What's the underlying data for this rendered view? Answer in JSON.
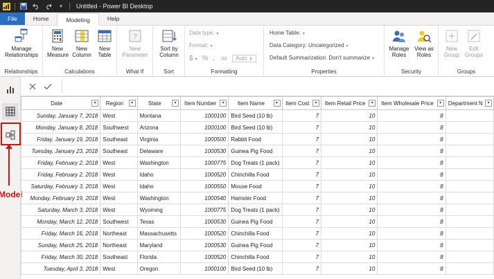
{
  "window": {
    "title": "Untitled - Power BI Desktop"
  },
  "tabs": [
    {
      "label": "File"
    },
    {
      "label": "Home"
    },
    {
      "label": "Modeling"
    },
    {
      "label": "Help"
    }
  ],
  "ribbon": {
    "relationships": {
      "manage_label": "Manage Relationships",
      "group": "Relationships"
    },
    "calculations": {
      "new_measure": "New Measure",
      "new_column": "New Column",
      "new_table": "New Table",
      "group": "Calculations"
    },
    "whatif": {
      "new_parameter": "New Parameter",
      "group": "What If"
    },
    "sort": {
      "sort_by_column": "Sort by Column",
      "group": "Sort"
    },
    "formatting": {
      "data_type": "Data type:",
      "format": "Format:",
      "currency": "$",
      "percent": "%",
      "comma": ",",
      "decimals": ".00",
      "auto": "Auto",
      "group": "Formatting"
    },
    "properties": {
      "home_table": "Home Table:",
      "data_category": "Data Category: Uncategorized",
      "default_summarization": "Default Summarization: Don't summarize",
      "group": "Properties"
    },
    "security": {
      "manage_roles": "Manage Roles",
      "view_as_roles": "View as Roles",
      "group": "Security"
    },
    "groups": {
      "new_group": "New Group",
      "edit_groups": "Edit Groups",
      "group": "Groups"
    }
  },
  "annotation": {
    "label": "Model"
  },
  "table": {
    "columns": [
      "Date",
      "Region",
      "State",
      "Item Number",
      "Item Name",
      "Item Cost",
      "Item Retail Price",
      "Item Wholesale Price",
      "Department N"
    ],
    "rows": [
      [
        "Sunday, January 7, 2018",
        "West",
        "Montana",
        "1000100",
        "Bird Seed (10 lb)",
        "7",
        "10",
        "8"
      ],
      [
        "Monday, January 8, 2018",
        "Southwest",
        "Arizona",
        "1000100",
        "Bird Seed (10 lb)",
        "7",
        "10",
        "8"
      ],
      [
        "Friday, January 19, 2018",
        "Southeast",
        "Virginia",
        "1000500",
        "Rabbit Food",
        "7",
        "10",
        "8"
      ],
      [
        "Tuesday, January 23, 2018",
        "Southeast",
        "Delaware",
        "1000530",
        "Guinea Pig Food",
        "7",
        "10",
        "8"
      ],
      [
        "Friday, February 2, 2018",
        "West",
        "Washington",
        "1000775",
        "Dog Treats (1 pack)",
        "7",
        "10",
        "8"
      ],
      [
        "Friday, February 2, 2018",
        "West",
        "Idaho",
        "1000520",
        "Chinchilla Food",
        "7",
        "10",
        "8"
      ],
      [
        "Saturday, February 3, 2018",
        "West",
        "Idaho",
        "1000550",
        "Mouse Food",
        "7",
        "10",
        "8"
      ],
      [
        "Monday, February 19, 2018",
        "West",
        "Washington",
        "1000540",
        "Hamster Food",
        "7",
        "10",
        "8"
      ],
      [
        "Saturday, March 3, 2018",
        "West",
        "Wyoming",
        "1000775",
        "Dog Treats (1 pack)",
        "7",
        "10",
        "8"
      ],
      [
        "Monday, March 12, 2018",
        "Southwest",
        "Texas",
        "1000530",
        "Guinea Pig Food",
        "7",
        "10",
        "8"
      ],
      [
        "Friday, March 16, 2018",
        "Northeast",
        "Massachusetts",
        "1000520",
        "Chinchilla Food",
        "7",
        "10",
        "8"
      ],
      [
        "Sunday, March 25, 2018",
        "Northeast",
        "Maryland",
        "1000530",
        "Guinea Pig Food",
        "7",
        "10",
        "8"
      ],
      [
        "Friday, March 30, 2018",
        "Southeast",
        "Florida",
        "1000520",
        "Chinchilla Food",
        "7",
        "10",
        "8"
      ],
      [
        "Tuesday, April 3, 2018",
        "West",
        "Oregon",
        "1000100",
        "Bird Seed (10 lb)",
        "7",
        "10",
        "8"
      ]
    ]
  },
  "colors": {
    "titlebar": "#242424",
    "accent": "#2b6fc0",
    "brand": "#f2c811",
    "annotation": "#d01010"
  }
}
